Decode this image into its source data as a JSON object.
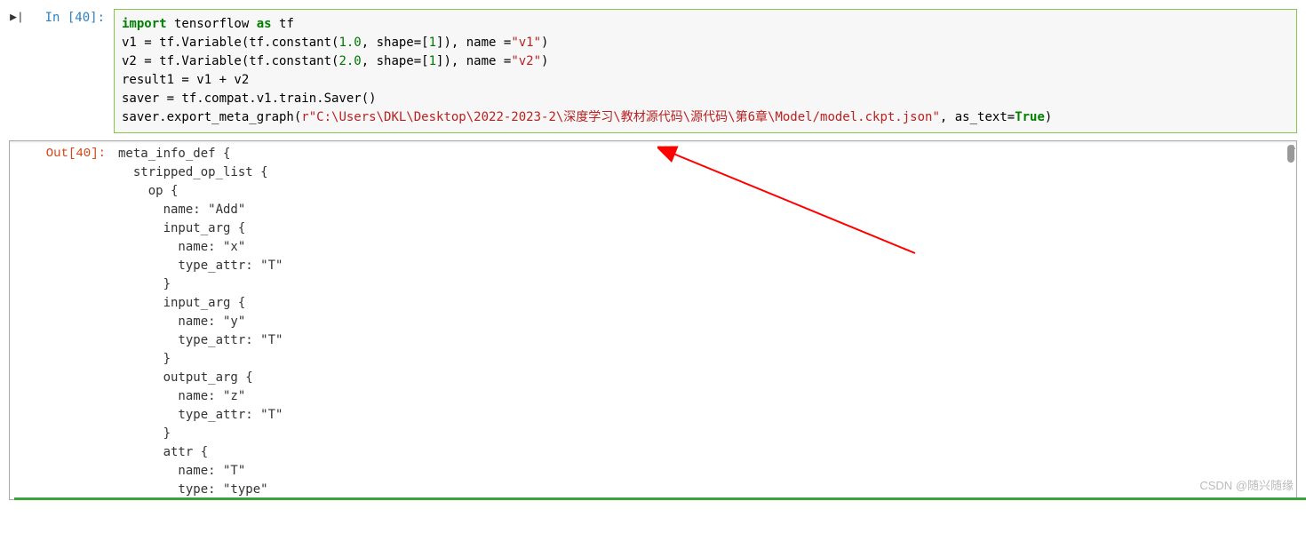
{
  "input_cell": {
    "prompt_label": "In  [40]:",
    "code": {
      "kw_import": "import",
      "mod": " tensorflow ",
      "kw_as": "as",
      "alias": " tf",
      "line2a": "v1 = tf.Variable(tf.constant(",
      "num1": "1.0",
      "sep1": ", shape=[",
      "numshape1": "1",
      "sep1b": "]), name =",
      "str1": "\"v1\"",
      "end1": ")",
      "line3a": "v2 = tf.Variable(tf.constant(",
      "num2": "2.0",
      "sep2": ", shape=[",
      "numshape2": "1",
      "sep2b": "]), name =",
      "str2": "\"v2\"",
      "end2": ")",
      "line4": "result1 = v1 + v2",
      "line5": "saver = tf.compat.v1.train.Saver()",
      "line6a": "saver.export_meta_graph(",
      "line6r": "r\"C:\\Users\\DKL\\Desktop\\2022-2023-2\\深度学习\\教材源代码\\源代码\\第6章\\Model/model.ckpt.json\"",
      "line6b": ", as_text=",
      "line6bool": "True",
      "line6c": ")"
    }
  },
  "output_cell": {
    "prompt_label": "Out[40]:",
    "text": "meta_info_def {\n  stripped_op_list {\n    op {\n      name: \"Add\"\n      input_arg {\n        name: \"x\"\n        type_attr: \"T\"\n      }\n      input_arg {\n        name: \"y\"\n        type_attr: \"T\"\n      }\n      output_arg {\n        name: \"z\"\n        type_attr: \"T\"\n      }\n      attr {\n        name: \"T\"\n        type: \"type\""
  },
  "watermark": "CSDN @随兴随缘"
}
